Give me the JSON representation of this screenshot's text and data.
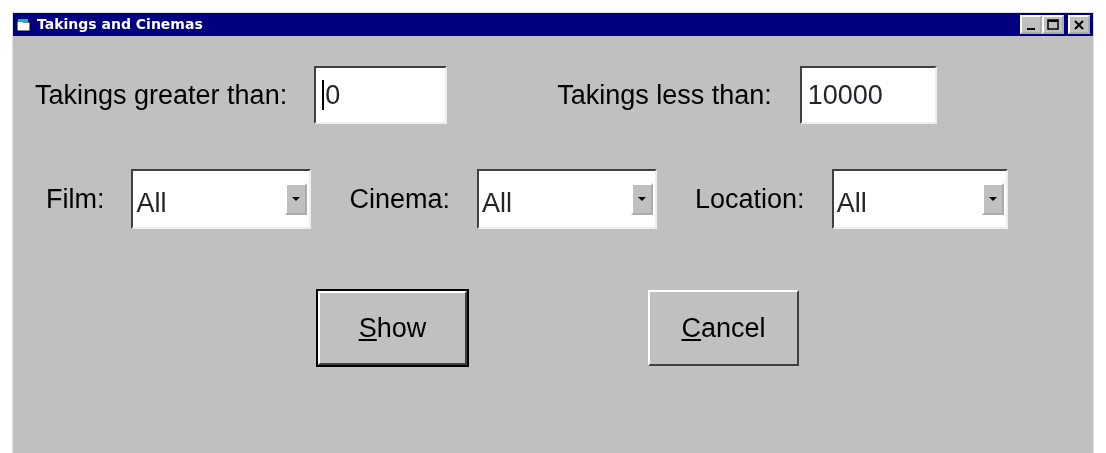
{
  "window": {
    "title": "Takings and Cinemas"
  },
  "takings_row": [
    {
      "label": "Takings greater than:",
      "value": "0",
      "focused": true
    },
    {
      "label": "Takings less than:",
      "value": "10000",
      "focused": false
    }
  ],
  "filters": [
    {
      "label": "Film:",
      "value": "All"
    },
    {
      "label": "Cinema:",
      "value": "All"
    },
    {
      "label": "Location:",
      "value": "All"
    }
  ],
  "buttons": [
    {
      "label": "Show",
      "first_letter_underlined": true,
      "default": true
    },
    {
      "label": "Cancel",
      "first_letter_underlined": true,
      "default": false
    }
  ]
}
